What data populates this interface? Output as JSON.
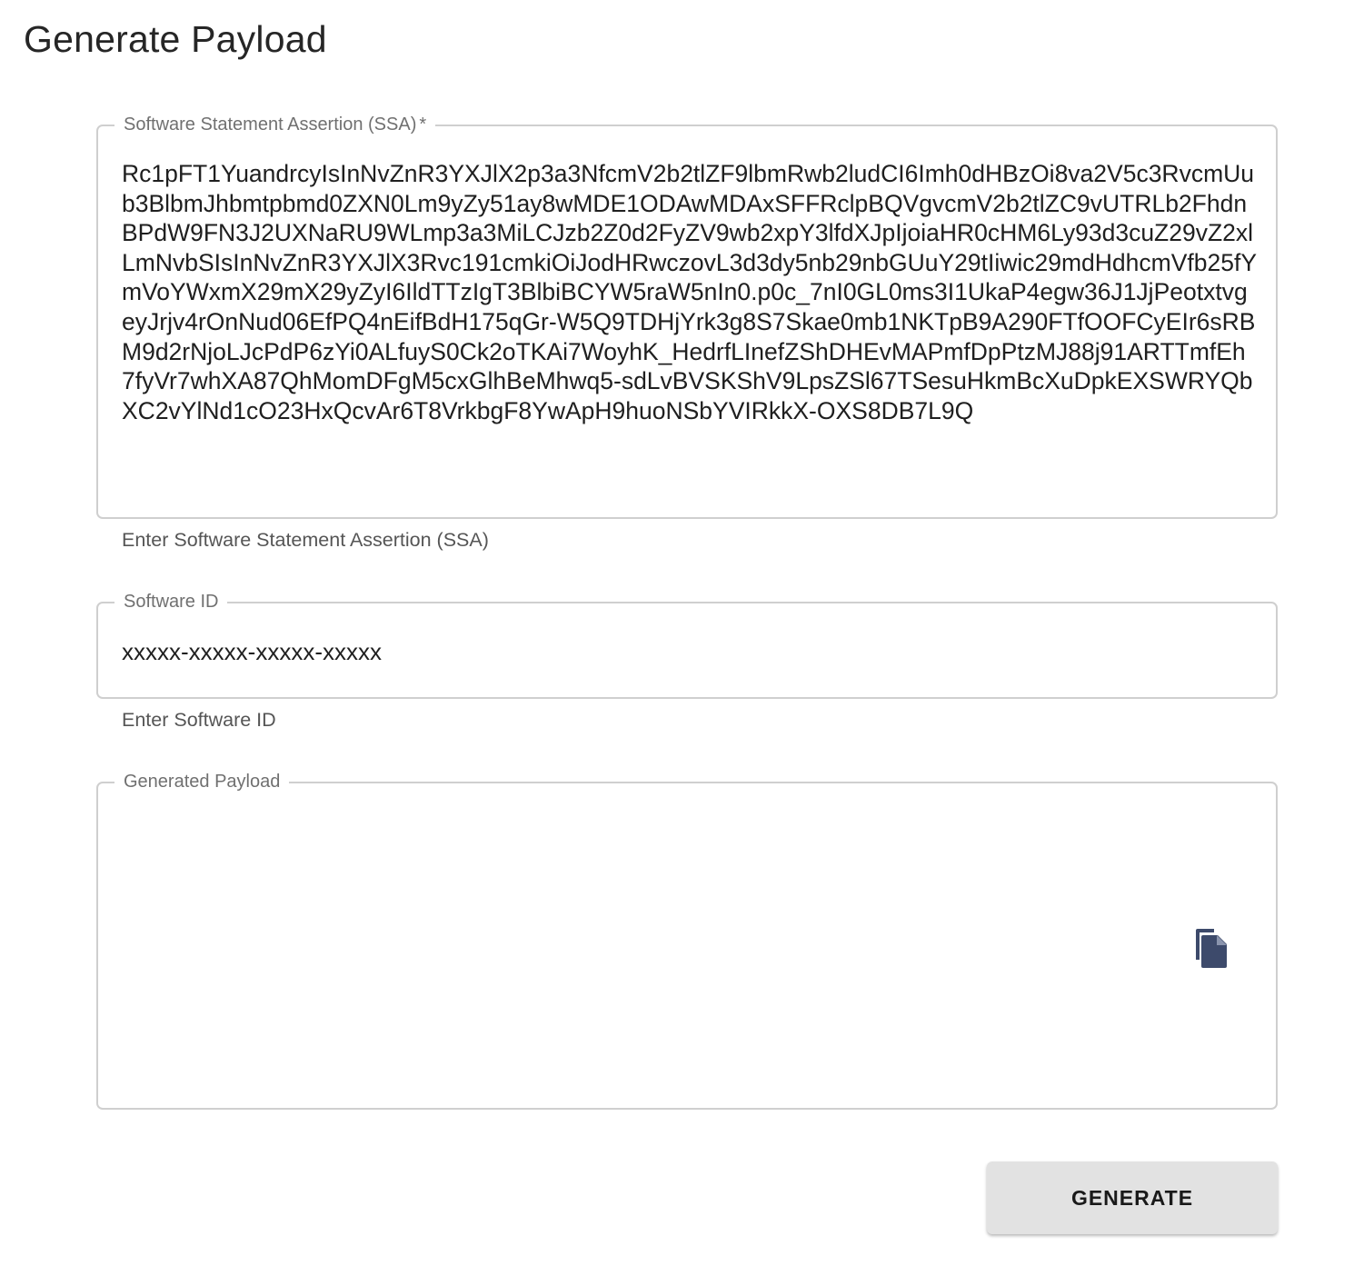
{
  "page": {
    "title": "Generate Payload"
  },
  "ssa_field": {
    "label": "Software Statement Assertion (SSA)",
    "required_marker": "*",
    "value": "Rc1pFT1YuandrcyIsInNvZnR3YXJlX2p3a3NfcmV2b2tlZF9lbmRwb2ludCI6Imh0dHBzOi8va2V5c3RvcmUub3BlbmJhbmtpbmd0ZXN0Lm9yZy51ay8wMDE1ODAwMDAxSFFRclpBQVgvcmV2b2tlZC9vUTRLb2FhdnBPdW9FN3J2UXNaRU9WLmp3a3MiLCJzb2Z0d2FyZV9wb2xpY3lfdXJpIjoiaHR0cHM6Ly93d3cuZ29vZ2xlLmNvbSIsInNvZnR3YXJlX3Rvc191cmkiOiJodHRwczovL3d3dy5nb29nbGUuY29tIiwic29mdHdhcmVfb25fYmVoYWxmX29mX29yZyI6IldTTzIgT3BlbiBCYW5raW5nIn0.p0c_7nI0GL0ms3I1UkaP4egw36J1JjPeotxtvgeyJrjv4rOnNud06EfPQ4nEifBdH175qGr-W5Q9TDHjYrk3g8S7Skae0mb1NKTpB9A290FTfOOFCyEIr6sRBM9d2rNjoLJcPdP6zYi0ALfuyS0Ck2oTKAi7WoyhK_HedrfLInefZShDHEvMAPmfDpPtzMJ88j91ARTTmfEh7fyVr7whXA87QhMomDFgM5cxGlhBeMhwq5-sdLvBVSKShV9LpsZSl67TSesuHkmBcXuDpkEXSWRYQbXC2vYlNd1cO23HxQcvAr6T8VrkbgF8YwApH9huoNSbYVIRkkX-OXS8DB7L9Q",
    "helper_text": "Enter Software Statement Assertion (SSA)"
  },
  "software_id_field": {
    "label": "Software ID",
    "value": "xxxxx-xxxxx-xxxxx-xxxxx",
    "helper_text": "Enter Software ID"
  },
  "payload_field": {
    "label": "Generated Payload",
    "value": "",
    "copy_icon": "copy-icon"
  },
  "actions": {
    "generate_label": "GENERATE"
  },
  "colors": {
    "border": "#cfcfcf",
    "label": "#707070",
    "helper": "#555555",
    "copy_icon": "#3d4a6b",
    "button_bg": "#e2e2e2"
  }
}
